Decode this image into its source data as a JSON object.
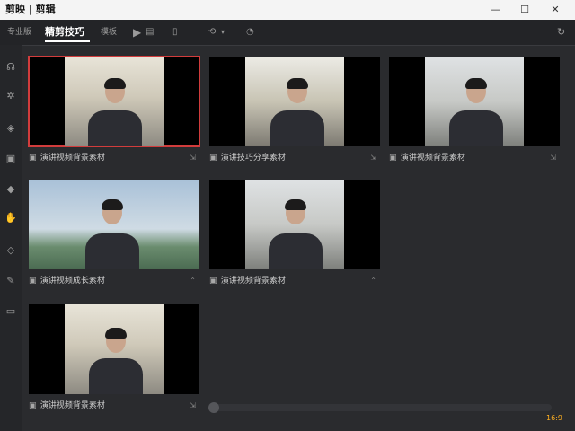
{
  "window": {
    "title": "剪映 | 剪辑",
    "minimize_glyph": "—",
    "maximize_glyph": "☐",
    "close_glyph": "✕"
  },
  "toolbar": {
    "items": [
      {
        "label": "专业版"
      },
      {
        "label": "精剪技巧"
      },
      {
        "label": "模板"
      }
    ]
  },
  "clips": [
    {
      "caption": "演讲视频背景素材"
    },
    {
      "caption": "演讲技巧分享素材"
    },
    {
      "caption": "演讲视频背景素材"
    },
    {
      "caption": "演讲视频成长素材"
    },
    {
      "caption": "演讲视频背景素材"
    },
    {
      "caption": "演讲视频背景素材"
    }
  ],
  "badges": {
    "label": "16:9"
  },
  "colors": {
    "accent_selected": "#d23c3c",
    "background": "#2a2b2e"
  }
}
